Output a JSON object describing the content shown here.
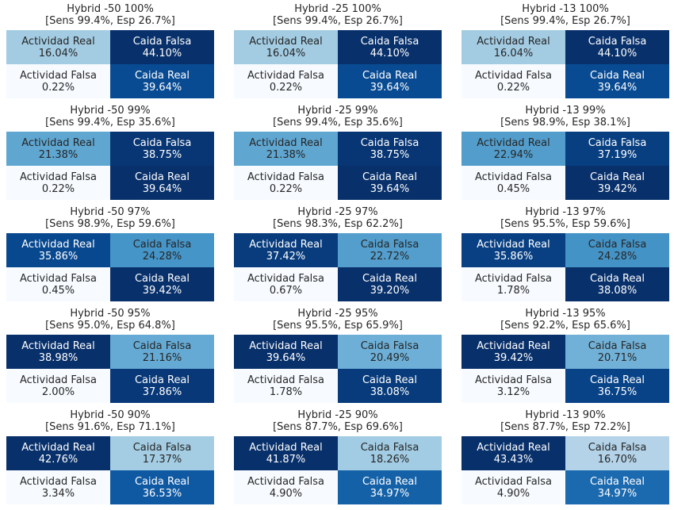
{
  "palette": {
    "stops": [
      "#f7fbff",
      "#deebf7",
      "#c6dbef",
      "#9ecae1",
      "#6baed6",
      "#4292c6",
      "#2171b5",
      "#08519c",
      "#08306b"
    ],
    "dark_text": "#262626",
    "light_text": "#ffffff"
  },
  "chart_data": {
    "type": "heatmap",
    "rows": 5,
    "cols": 3,
    "cell_labels": [
      [
        "Actividad Real",
        "Caida Falsa"
      ],
      [
        "Actividad Falsa",
        "Caida Real"
      ]
    ],
    "panels": [
      {
        "title": "Hybrid -50 100%",
        "subtitle": "[Sens 99.4%, Esp 26.7%]",
        "values": [
          [
            "16.04%",
            "44.10%"
          ],
          [
            "0.22%",
            "39.64%"
          ]
        ],
        "nums": [
          [
            16.04,
            44.1
          ],
          [
            0.22,
            39.64
          ]
        ]
      },
      {
        "title": "Hybrid -25 100%",
        "subtitle": "[Sens 99.4%, Esp 26.7%]",
        "values": [
          [
            "16.04%",
            "44.10%"
          ],
          [
            "0.22%",
            "39.64%"
          ]
        ],
        "nums": [
          [
            16.04,
            44.1
          ],
          [
            0.22,
            39.64
          ]
        ]
      },
      {
        "title": "Hybrid -13 100%",
        "subtitle": "[Sens 99.4%, Esp 26.7%]",
        "values": [
          [
            "16.04%",
            "44.10%"
          ],
          [
            "0.22%",
            "39.64%"
          ]
        ],
        "nums": [
          [
            16.04,
            44.1
          ],
          [
            0.22,
            39.64
          ]
        ]
      },
      {
        "title": "Hybrid -50 99%",
        "subtitle": "[Sens 99.4%, Esp 35.6%]",
        "values": [
          [
            "21.38%",
            "38.75%"
          ],
          [
            "0.22%",
            "39.64%"
          ]
        ],
        "nums": [
          [
            21.38,
            38.75
          ],
          [
            0.22,
            39.64
          ]
        ]
      },
      {
        "title": "Hybrid -25 99%",
        "subtitle": "[Sens 99.4%, Esp 35.6%]",
        "values": [
          [
            "21.38%",
            "38.75%"
          ],
          [
            "0.22%",
            "39.64%"
          ]
        ],
        "nums": [
          [
            21.38,
            38.75
          ],
          [
            0.22,
            39.64
          ]
        ]
      },
      {
        "title": "Hybrid -13 99%",
        "subtitle": "[Sens 98.9%, Esp 38.1%]",
        "values": [
          [
            "22.94%",
            "37.19%"
          ],
          [
            "0.45%",
            "39.42%"
          ]
        ],
        "nums": [
          [
            22.94,
            37.19
          ],
          [
            0.45,
            39.42
          ]
        ]
      },
      {
        "title": "Hybrid -50 97%",
        "subtitle": "[Sens 98.9%, Esp 59.6%]",
        "values": [
          [
            "35.86%",
            "24.28%"
          ],
          [
            "0.45%",
            "39.42%"
          ]
        ],
        "nums": [
          [
            35.86,
            24.28
          ],
          [
            0.45,
            39.42
          ]
        ]
      },
      {
        "title": "Hybrid -25 97%",
        "subtitle": "[Sens 98.3%, Esp 62.2%]",
        "values": [
          [
            "37.42%",
            "22.72%"
          ],
          [
            "0.67%",
            "39.20%"
          ]
        ],
        "nums": [
          [
            37.42,
            22.72
          ],
          [
            0.67,
            39.2
          ]
        ]
      },
      {
        "title": "Hybrid -13 97%",
        "subtitle": "[Sens 95.5%, Esp 59.6%]",
        "values": [
          [
            "35.86%",
            "24.28%"
          ],
          [
            "1.78%",
            "38.08%"
          ]
        ],
        "nums": [
          [
            35.86,
            24.28
          ],
          [
            1.78,
            38.08
          ]
        ]
      },
      {
        "title": "Hybrid -50 95%",
        "subtitle": "[Sens 95.0%, Esp 64.8%]",
        "values": [
          [
            "38.98%",
            "21.16%"
          ],
          [
            "2.00%",
            "37.86%"
          ]
        ],
        "nums": [
          [
            38.98,
            21.16
          ],
          [
            2.0,
            37.86
          ]
        ]
      },
      {
        "title": "Hybrid -25 95%",
        "subtitle": "[Sens 95.5%, Esp 65.9%]",
        "values": [
          [
            "39.64%",
            "20.49%"
          ],
          [
            "1.78%",
            "38.08%"
          ]
        ],
        "nums": [
          [
            39.64,
            20.49
          ],
          [
            1.78,
            38.08
          ]
        ]
      },
      {
        "title": "Hybrid -13 95%",
        "subtitle": "[Sens 92.2%, Esp 65.6%]",
        "values": [
          [
            "39.42%",
            "20.71%"
          ],
          [
            "3.12%",
            "36.75%"
          ]
        ],
        "nums": [
          [
            39.42,
            20.71
          ],
          [
            3.12,
            36.75
          ]
        ]
      },
      {
        "title": "Hybrid -50 90%",
        "subtitle": "[Sens 91.6%, Esp 71.1%]",
        "values": [
          [
            "42.76%",
            "17.37%"
          ],
          [
            "3.34%",
            "36.53%"
          ]
        ],
        "nums": [
          [
            42.76,
            17.37
          ],
          [
            3.34,
            36.53
          ]
        ]
      },
      {
        "title": "Hybrid -25 90%",
        "subtitle": "[Sens 87.7%, Esp 69.6%]",
        "values": [
          [
            "41.87%",
            "18.26%"
          ],
          [
            "4.90%",
            "34.97%"
          ]
        ],
        "nums": [
          [
            41.87,
            18.26
          ],
          [
            4.9,
            34.97
          ]
        ]
      },
      {
        "title": "Hybrid -13 90%",
        "subtitle": "[Sens 87.7%, Esp 72.2%]",
        "values": [
          [
            "43.43%",
            "16.70%"
          ],
          [
            "4.90%",
            "34.97%"
          ]
        ],
        "nums": [
          [
            43.43,
            16.7
          ],
          [
            4.9,
            34.97
          ]
        ]
      }
    ]
  }
}
